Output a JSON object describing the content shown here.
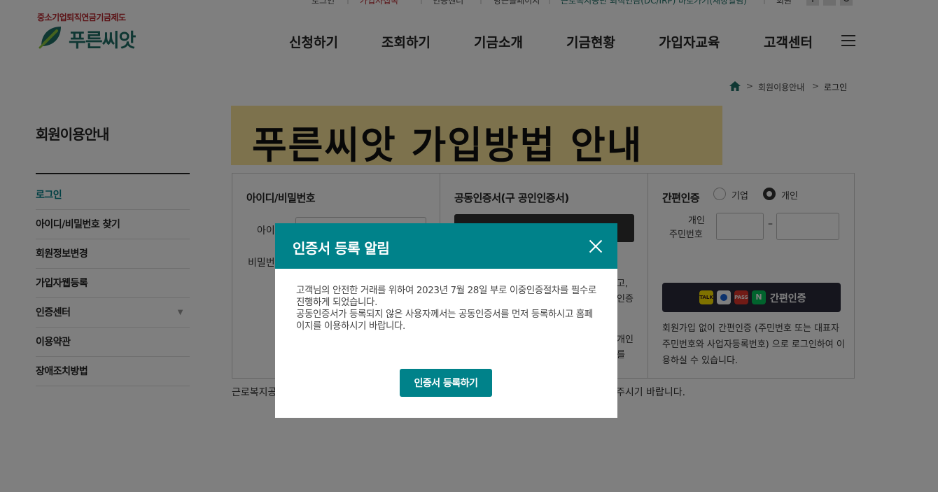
{
  "util_bar": {
    "items": [
      "로그인",
      "가입자접속",
      "인증센터",
      "당근올페이지",
      "근로복지공단 퇴직연금(DC/IRP) 바로가기(새창열림)",
      "회원"
    ]
  },
  "header": {
    "logo_sub": "중소기업퇴직연금기금제도",
    "logo_text": "푸른씨앗",
    "gnb": [
      "신청하기",
      "조회하기",
      "기금소개",
      "기금현황",
      "가입자교육",
      "고객센터"
    ]
  },
  "breadcrumb": {
    "items": [
      "회원이용안내",
      "로그인"
    ]
  },
  "lnb": {
    "title": "회원이용안내",
    "items": [
      "로그인",
      "아이디/비밀번호 찾기",
      "회원정보변경",
      "가입자웹등록",
      "인증센터",
      "이용약관",
      "장애조치방법"
    ]
  },
  "banner": {
    "text": "푸른씨앗 가입방법 안내"
  },
  "login": {
    "id_box": {
      "title": "아이디/비밀번호",
      "id_label": "아이",
      "pw_label": "비밀번"
    },
    "cert_box": {
      "title": "공동인증서(구 공인인증서)",
      "edge_lines": [
        "고,",
        "인증",
        "개인",
        "를"
      ]
    },
    "simple_box": {
      "title": "간편인증",
      "radio_corp": "기업",
      "radio_person": "개인",
      "selected": "개인",
      "rrn_label_1": "개인",
      "rrn_label_2": "주민번호",
      "dash": "–",
      "button_label": "간편인증",
      "provider_icons": [
        "TALK",
        "PASS",
        "N"
      ],
      "desc": "회원가입 없이 간편인증 (주민번호 또는 대표자 주민번호와 사업자등록번호) 으로 로그인하여 이용하실 수 있습니다."
    }
  },
  "footnote": {
    "left": "근로복지공",
    "right": "주시기 바랍니다."
  },
  "modal": {
    "title": "인증서 등록 알림",
    "paragraph1": "고객님의 안전한 거래를 위하여 2023년 7월 28일 부로 이중인증절차를 필수로 진행하게 되었습니다.",
    "paragraph2": "공동인증서가 등록되지 않은 사용자께서는 공동인증서를 먼저 등록하시고 홈페이지를 이용하시기 바랍니다.",
    "button": "인증서 등록하기"
  },
  "colors": {
    "brand_teal": "#00828a",
    "banner_yellow": "#fbe49a",
    "overlay": "rgba(0,0,0,0.5)"
  }
}
